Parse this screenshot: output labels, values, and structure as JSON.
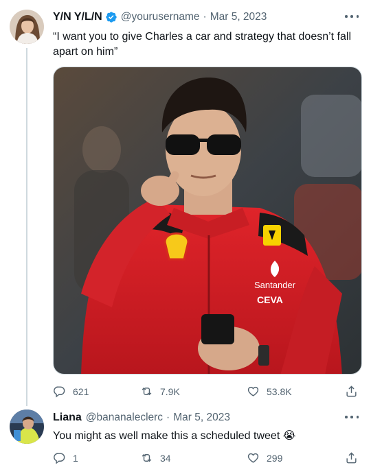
{
  "tweet": {
    "display_name": "Y/N Y/L/N",
    "handle": "@yourusername",
    "separator": "·",
    "date": "Mar 5, 2023",
    "text_line1": "“I want you to give Charles a car and strategy that doesn’t fall",
    "text_line2": "apart on him”",
    "media_brands": {
      "shirt": "Santander",
      "sponsor": "CEVA"
    },
    "replies": "621",
    "retweets": "7.9K",
    "likes": "53.8K"
  },
  "reply": {
    "display_name": "Liana",
    "handle": "@bananaleclerc",
    "separator": "·",
    "date": "Mar 5, 2023",
    "text": "You might as well make this a scheduled tweet 😭",
    "replies": "1",
    "retweets": "34",
    "likes": "299"
  },
  "icons": {
    "verified": "verified-badge-icon",
    "more": "more-options-icon",
    "reply": "reply-icon",
    "retweet": "retweet-icon",
    "like": "heart-icon",
    "share": "share-icon"
  },
  "colors": {
    "accent": "#1d9bf0",
    "text": "#0f1419",
    "secondary": "#536471",
    "divider": "#cfd9de"
  }
}
